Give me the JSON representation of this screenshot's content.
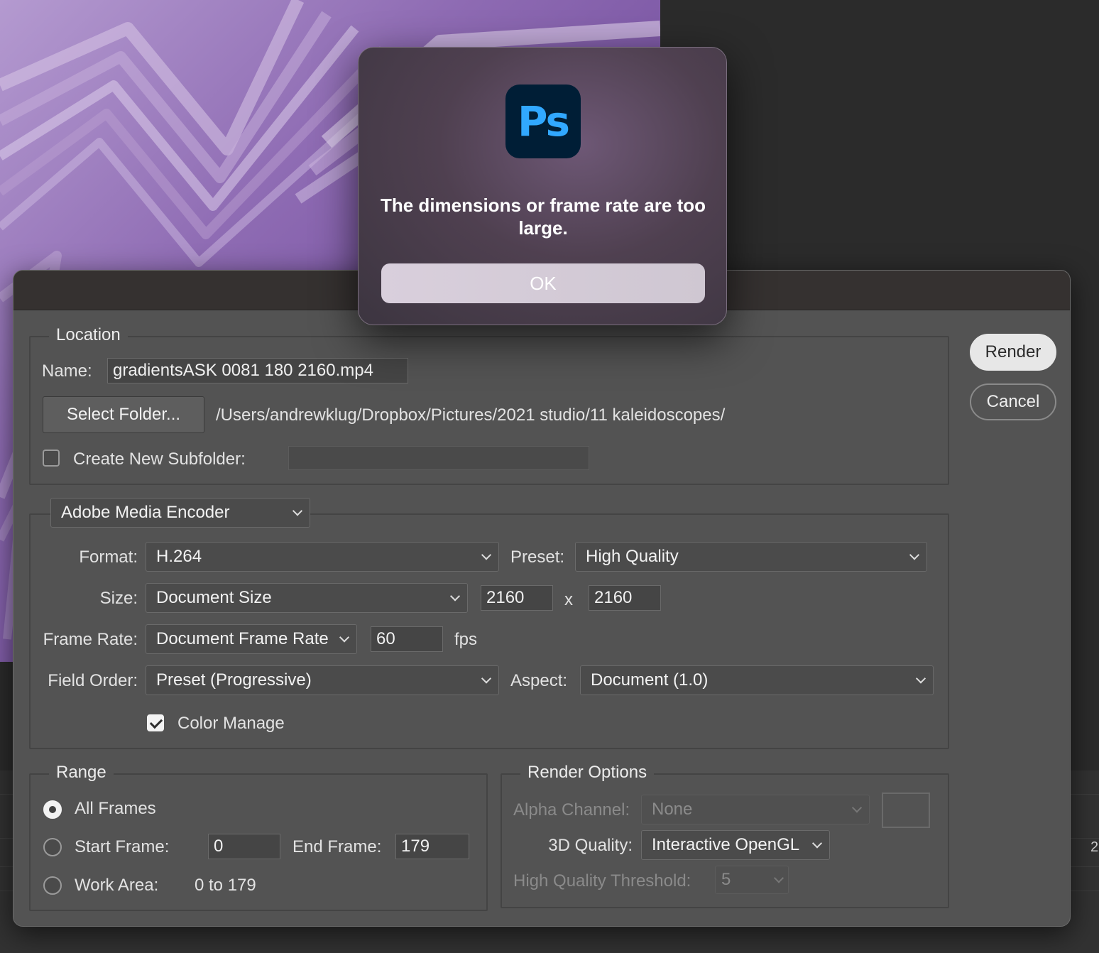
{
  "alert": {
    "message": "The dimensions or frame rate are too large.",
    "ok_label": "OK",
    "icon_text": "Ps"
  },
  "dialog": {
    "render_label": "Render",
    "cancel_label": "Cancel",
    "location": {
      "title": "Location",
      "name_label": "Name:",
      "name_value": "gradientsASK 0081 180 2160.mp4",
      "select_folder_label": "Select Folder...",
      "folder_path": "/Users/andrewklug/Dropbox/Pictures/2021 studio/11 kaleidoscopes/",
      "subfolder_label": "Create New Subfolder:",
      "subfolder_value": "",
      "subfolder_checked": false
    },
    "encoder": {
      "selected": "Adobe Media Encoder",
      "format_label": "Format:",
      "format_value": "H.264",
      "preset_label": "Preset:",
      "preset_value": "High Quality",
      "size_label": "Size:",
      "size_value": "Document Size",
      "width": "2160",
      "x_sep": "x",
      "height": "2160",
      "frame_rate_label": "Frame Rate:",
      "frame_rate_value": "Document Frame Rate",
      "fps_value": "60",
      "fps_unit": "fps",
      "field_order_label": "Field Order:",
      "field_order_value": "Preset (Progressive)",
      "aspect_label": "Aspect:",
      "aspect_value": "Document (1.0)",
      "color_manage_label": "Color Manage",
      "color_manage_checked": true
    },
    "range": {
      "title": "Range",
      "all_frames_label": "All Frames",
      "start_frame_label": "Start Frame:",
      "start_frame_value": "0",
      "end_frame_label": "End Frame:",
      "end_frame_value": "179",
      "work_area_label": "Work Area:",
      "work_area_value": "0 to 179",
      "selected": "All Frames"
    },
    "render_options": {
      "title": "Render Options",
      "alpha_label": "Alpha Channel:",
      "alpha_value": "None",
      "quality_label": "3D Quality:",
      "quality_value": "Interactive OpenGL",
      "threshold_label": "High Quality Threshold:",
      "threshold_value": "5"
    }
  },
  "background": {
    "right_edge_digit": "2"
  },
  "colors": {
    "ps_blue": "#31a8ff",
    "ps_navy": "#001e36",
    "dialog_bg": "#535353"
  }
}
